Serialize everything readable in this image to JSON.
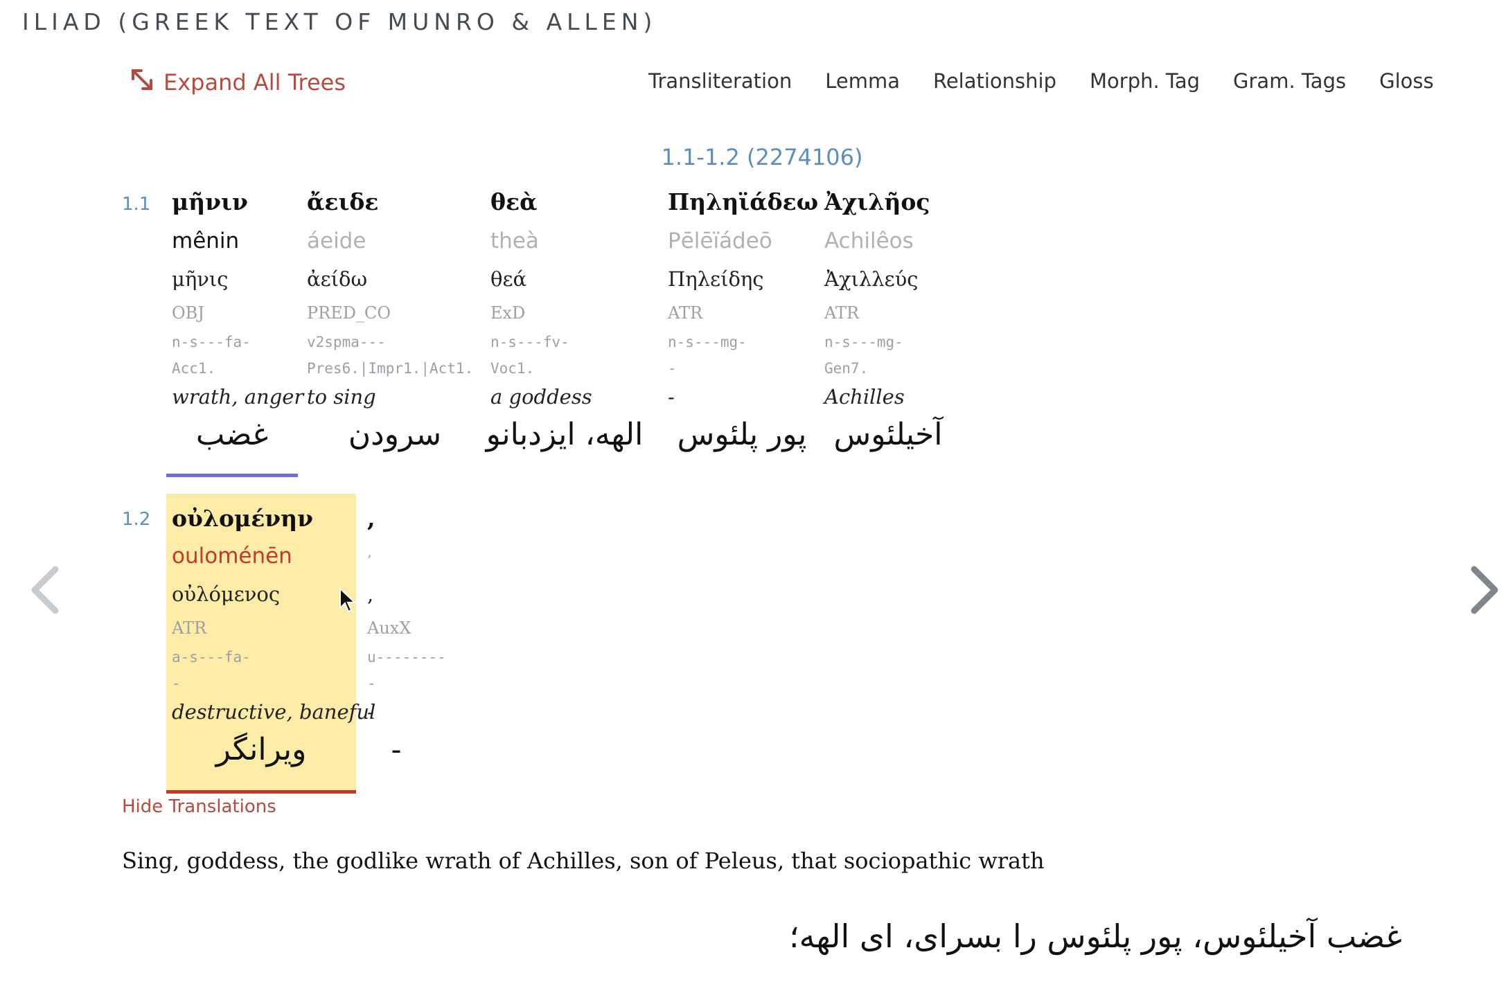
{
  "app": {
    "title": "ILIAD (GREEK TEXT OF MUNRO & ALLEN)"
  },
  "toolbar": {
    "expand_label": "Expand All Trees",
    "toggles": [
      "Transliteration",
      "Lemma",
      "Relationship",
      "Morph. Tag",
      "Gram. Tags",
      "Gloss"
    ]
  },
  "passage": {
    "reference": "1.1-1.2 (2274106)"
  },
  "lines": [
    {
      "num": "1.1",
      "words": [
        {
          "greek": "μῆνιν",
          "translit": "mênin",
          "lemma": "μῆνις",
          "rel": "OBJ",
          "morph": "n-s---fa-",
          "gram": "Acc1.",
          "gloss": "wrath, anger",
          "persian": "غضب"
        },
        {
          "greek": "ἄειδε",
          "translit": "áeide",
          "lemma": "ἀείδω",
          "rel": "PRED_CO",
          "morph": "v2spma---",
          "gram": "Pres6.|Impr1.|Act1.",
          "gloss": "to sing",
          "persian": "سرودن"
        },
        {
          "greek": "θεὰ",
          "translit": "theà",
          "lemma": "θεά",
          "rel": "ExD",
          "morph": "n-s---fv-",
          "gram": "Voc1.",
          "gloss": "a goddess",
          "persian": "الهه، ایزدبانو"
        },
        {
          "greek": "Πηληϊάδεω",
          "translit": "Pēlēïádeō",
          "lemma": "Πηλείδης",
          "rel": "ATR",
          "morph": "n-s---mg-",
          "gram": "-",
          "gloss": "-",
          "persian": "پور پلئوس"
        },
        {
          "greek": "Ἀχιλῆος",
          "translit": "Achilêos",
          "lemma": "Ἀχιλλεύς",
          "rel": "ATR",
          "morph": "n-s---mg-",
          "gram": "Gen7.",
          "gloss": "Achilles",
          "persian": "آخیلئوس"
        }
      ]
    },
    {
      "num": "1.2",
      "words": [
        {
          "greek": "οὐλομένην",
          "translit": "ouloménēn",
          "lemma": "οὐλόμενος",
          "rel": "ATR",
          "morph": "a-s---fa-",
          "gram": "-",
          "gloss": "destructive, baneful",
          "persian": "ویرانگر"
        },
        {
          "greek": ",",
          "translit": ",",
          "lemma": ",",
          "rel": "AuxX",
          "morph": "u--------",
          "gram": "-",
          "gloss": "-",
          "persian": "-"
        }
      ]
    }
  ],
  "translations": {
    "hide_label": "Hide Translations",
    "english": "Sing, goddess, the godlike wrath of Achilles, son of Peleus, that sociopathic wrath",
    "persian": "غضب آخیلئوس، پور پلئوس را بسرای، ای الهه؛"
  },
  "nav": {
    "prev_icon": "chevron-left-icon",
    "next_icon": "chevron-right-icon"
  },
  "colors": {
    "accent_red": "#b54b3e",
    "link_blue": "#5b8ec0",
    "highlight": "#fdeca7",
    "underline_blue": "#6b6ce0",
    "underline_red": "#c33a2c"
  }
}
